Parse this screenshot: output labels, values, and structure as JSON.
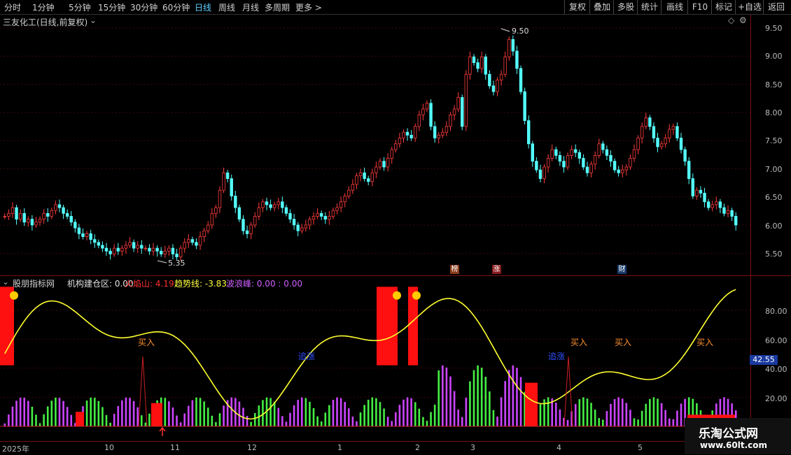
{
  "toolbar": {
    "periods": [
      "分时",
      "1分钟",
      "5分钟",
      "15分钟",
      "30分钟",
      "60分钟",
      "日线",
      "周线",
      "月线",
      "多周期",
      "更多 >"
    ],
    "active_period": "日线",
    "tools": [
      "复权",
      "叠加",
      "多股",
      "统计",
      "画线",
      "F10",
      "标记",
      "+自选",
      "返回"
    ]
  },
  "main": {
    "title": "三友化工(日线,前复权)",
    "high_label": "9.50",
    "low_label": "5.35",
    "y_ticks": [
      "9.50",
      "9.00",
      "8.50",
      "8.00",
      "7.50",
      "7.00",
      "6.50",
      "6.00",
      "5.50"
    ],
    "badges": [
      "榜",
      "涨",
      "财"
    ]
  },
  "indicator": {
    "name": "股朋指标网",
    "items": [
      {
        "label": "机构建仓区: 0.00",
        "color": "#e0e0e0"
      },
      {
        "label": "火焰山: 4.19",
        "color": "#ff3030"
      },
      {
        "label": "趋势线: -3.83",
        "color": "#ffff40"
      },
      {
        "label": "波浪峰: 0.00 : 0.00",
        "color": "#d060ff"
      }
    ],
    "y_ticks": [
      "80.00",
      "60.00",
      "40.00",
      "20.00"
    ],
    "current_value": "42.55",
    "signals": {
      "buy": "买入",
      "chase": "追涨"
    }
  },
  "xaxis": {
    "labels": [
      "2025年",
      "10",
      "11",
      "12",
      "1",
      "2",
      "3",
      "4",
      "5"
    ]
  },
  "watermark": {
    "line1": "乐淘公式网",
    "line2": "www.60lt.com"
  },
  "colors": {
    "up": "#ff3c3c",
    "down": "#54ffff",
    "trend": "#ffff30",
    "purple": "#cc44ff",
    "green": "#44ee44",
    "fire": "#ff1010"
  },
  "chart_data": {
    "type": "candlestick",
    "title": "三友化工(日线,前复权)",
    "ylim": [
      5.3,
      9.7
    ],
    "closes": [
      6.15,
      6.2,
      6.3,
      6.1,
      6.2,
      6.05,
      6.1,
      6.0,
      6.05,
      6.1,
      6.2,
      6.15,
      6.25,
      6.35,
      6.3,
      6.2,
      6.15,
      6.05,
      5.95,
      5.85,
      5.8,
      5.85,
      5.75,
      5.7,
      5.65,
      5.6,
      5.55,
      5.5,
      5.6,
      5.55,
      5.6,
      5.65,
      5.7,
      5.6,
      5.65,
      5.6,
      5.6,
      5.55,
      5.6,
      5.55,
      5.5,
      5.55,
      5.6,
      5.5,
      5.45,
      5.6,
      5.7,
      5.75,
      5.7,
      5.65,
      5.8,
      5.9,
      6.0,
      6.2,
      6.3,
      6.6,
      6.9,
      6.8,
      6.5,
      6.3,
      6.1,
      5.9,
      5.85,
      6.0,
      6.15,
      6.3,
      6.4,
      6.35,
      6.3,
      6.35,
      6.4,
      6.3,
      6.2,
      6.1,
      6.0,
      5.9,
      5.95,
      6.0,
      6.1,
      6.15,
      6.2,
      6.15,
      6.1,
      6.15,
      6.25,
      6.3,
      6.4,
      6.5,
      6.6,
      6.7,
      6.85,
      6.9,
      6.8,
      6.75,
      6.9,
      7.0,
      7.1,
      7.0,
      7.15,
      7.3,
      7.4,
      7.5,
      7.6,
      7.55,
      7.5,
      7.7,
      7.9,
      8.0,
      8.1,
      7.7,
      7.5,
      7.55,
      7.6,
      7.7,
      7.9,
      8.0,
      8.2,
      7.7,
      8.6,
      8.9,
      8.8,
      8.7,
      8.9,
      8.6,
      8.4,
      8.3,
      8.5,
      8.6,
      8.9,
      9.2,
      9.0,
      8.7,
      8.3,
      7.8,
      7.4,
      7.1,
      6.95,
      6.8,
      7.0,
      7.15,
      7.3,
      7.2,
      7.1,
      7.0,
      7.2,
      7.3,
      7.25,
      7.15,
      7.0,
      6.9,
      7.05,
      7.2,
      7.4,
      7.3,
      7.2,
      7.1,
      6.95,
      6.9,
      6.95,
      7.0,
      7.15,
      7.3,
      7.5,
      7.7,
      7.85,
      7.7,
      7.5,
      7.35,
      7.4,
      7.5,
      7.65,
      7.7,
      7.5,
      7.3,
      7.1,
      6.8,
      6.5,
      6.6,
      6.55,
      6.4,
      6.3,
      6.35,
      6.4,
      6.3,
      6.2,
      6.25,
      6.15,
      6.0
    ]
  }
}
